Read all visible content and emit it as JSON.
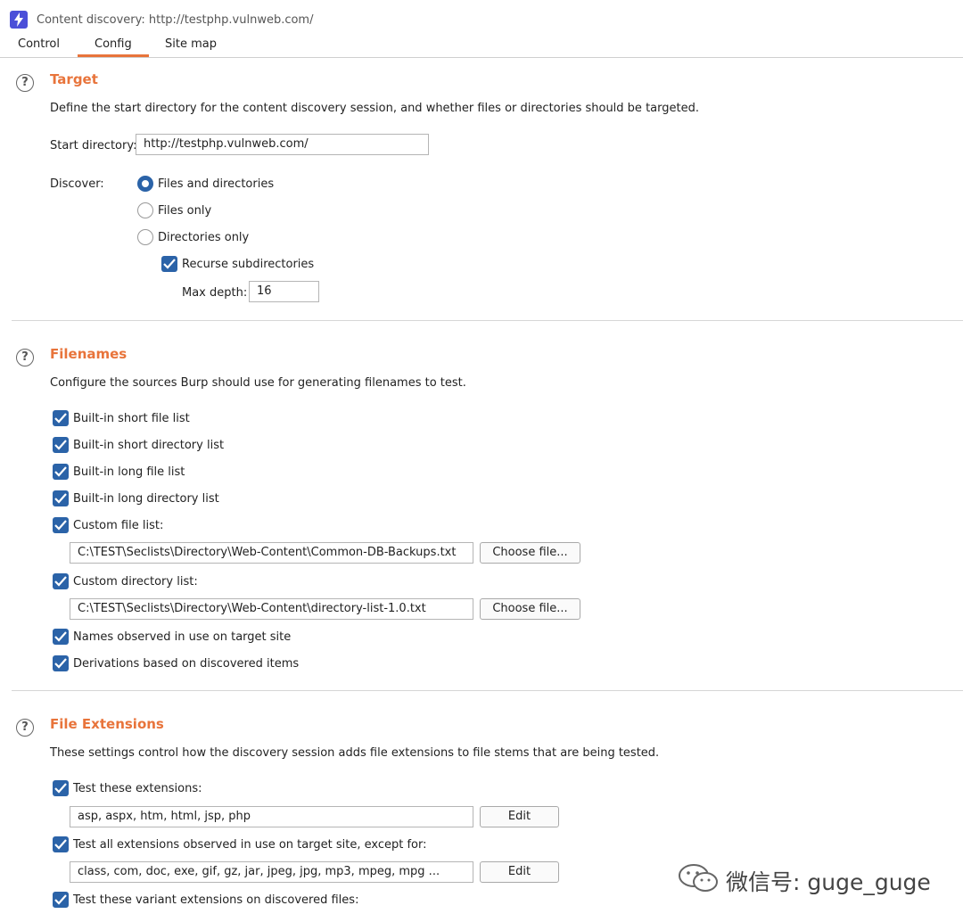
{
  "window": {
    "title": "Content discovery: http://testphp.vulnweb.com/"
  },
  "tabs": [
    {
      "label": "Control"
    },
    {
      "label": "Config"
    },
    {
      "label": "Site map"
    }
  ],
  "target": {
    "title": "Target",
    "description": "Define the start directory for the content discovery session, and whether files or directories should be targeted.",
    "start_directory_label": "Start directory:",
    "start_directory_value": "http://testphp.vulnweb.com/",
    "discover_label": "Discover:",
    "options": [
      {
        "label": "Files and directories",
        "selected": true
      },
      {
        "label": "Files only",
        "selected": false
      },
      {
        "label": "Directories only",
        "selected": false
      }
    ],
    "recurse_label": "Recurse subdirectories",
    "recurse_checked": true,
    "max_depth_label": "Max depth:",
    "max_depth_value": "16"
  },
  "filenames": {
    "title": "Filenames",
    "description": "Configure the sources Burp should use for generating filenames to test.",
    "builtin_short_file": "Built-in short file list",
    "builtin_short_dir": "Built-in short directory list",
    "builtin_long_file": "Built-in long file list",
    "builtin_long_dir": "Built-in long directory list",
    "custom_file_label": "Custom file list:",
    "custom_file_path": "C:\\TEST\\Seclists\\Directory\\Web-Content\\Common-DB-Backups.txt",
    "custom_dir_label": "Custom directory list:",
    "custom_dir_path": "C:\\TEST\\Seclists\\Directory\\Web-Content\\directory-list-1.0.txt",
    "choose_file": "Choose file...",
    "names_observed": "Names observed in use on target site",
    "derivations": "Derivations based on discovered items"
  },
  "file_extensions": {
    "title": "File Extensions",
    "description": "These settings control how the discovery session adds file extensions to file stems that are being tested.",
    "test_these_label": "Test these extensions:",
    "test_these_value": "asp, aspx, htm, html, jsp, php",
    "test_observed_label": "Test all extensions observed in use on target site, except for:",
    "test_observed_value": "class, com, doc, exe, gif, gz, jar, jpeg, jpg, mp3, mpeg, mpg ...",
    "variant_label": "Test these variant extensions on discovered files:",
    "edit_label": "Edit"
  },
  "watermark": {
    "text": "微信号: guge_guge"
  },
  "colors": {
    "accent": "#e8743b",
    "checkbox": "#2b63a8",
    "app_icon": "#4b4fd8"
  }
}
